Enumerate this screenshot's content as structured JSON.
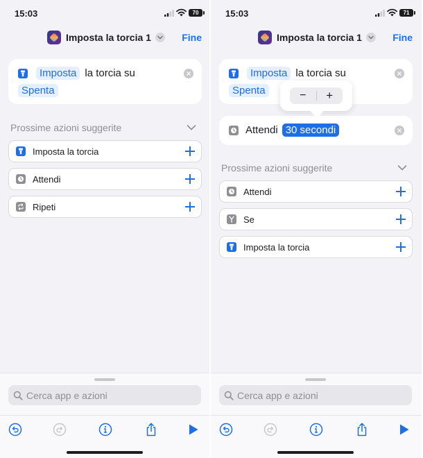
{
  "status": {
    "time": "15:03",
    "battery_left": "70",
    "battery_right": "71"
  },
  "nav": {
    "title": "Imposta la torcia 1",
    "done_label": "Fine"
  },
  "left": {
    "action": {
      "verb": "Imposta",
      "text": "la torcia su",
      "value": "Spenta"
    },
    "suggestions_title": "Prossime azioni suggerite",
    "suggestions": [
      {
        "label": "Imposta la torcia",
        "icon": "flashlight-icon"
      },
      {
        "label": "Attendi",
        "icon": "clock-icon"
      },
      {
        "label": "Ripeti",
        "icon": "repeat-icon"
      }
    ]
  },
  "right": {
    "action": {
      "verb": "Imposta",
      "text": "la torcia su",
      "value": "Spenta"
    },
    "wait_action": {
      "label": "Attendi",
      "value": "30 secondi"
    },
    "stepper": {
      "minus": "−",
      "plus": "+"
    },
    "suggestions_title": "Prossime azioni suggerite",
    "suggestions": [
      {
        "label": "Attendi",
        "icon": "clock-icon"
      },
      {
        "label": "Se",
        "icon": "branch-icon"
      },
      {
        "label": "Imposta la torcia",
        "icon": "flashlight-icon"
      }
    ]
  },
  "search": {
    "placeholder": "Cerca app e azioni"
  },
  "toolbar": [
    "undo-icon",
    "redo-icon",
    "info-icon",
    "share-icon",
    "play-icon"
  ],
  "colors": {
    "accent": "#1e6ee8",
    "token_bg": "#e4efff",
    "background": "#f2f2f7"
  }
}
